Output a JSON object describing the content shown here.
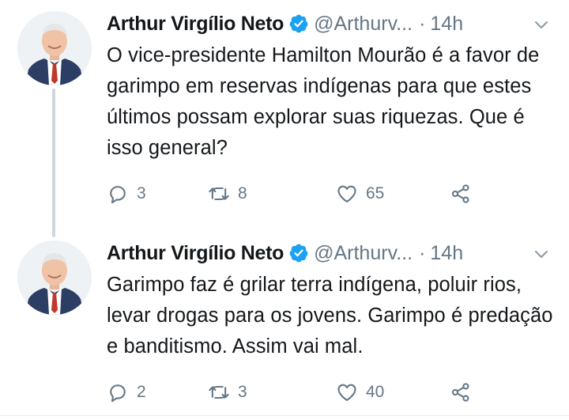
{
  "colors": {
    "verified": "#1da1f2",
    "secondary_text": "#657786",
    "thread_line": "#ccd6dd"
  },
  "tweets": [
    {
      "author_name": "Arthur Virgílio Neto",
      "handle": "@Arthurv...",
      "separator": "·",
      "time": "14h",
      "text": "O vice-presidente Hamilton Mourão é a favor de garimpo em reservas indígenas para que estes últimos possam explorar suas riquezas. Que é isso general?",
      "replies": "3",
      "retweets": "8",
      "likes": "65"
    },
    {
      "author_name": "Arthur Virgílio Neto",
      "handle": "@Arthurv...",
      "separator": "·",
      "time": "14h",
      "text": "Garimpo faz é grilar terra indígena, poluir rios, levar drogas para os jovens. Garimpo é predação e banditismo. Assim vai mal.",
      "replies": "2",
      "retweets": "3",
      "likes": "40"
    }
  ]
}
